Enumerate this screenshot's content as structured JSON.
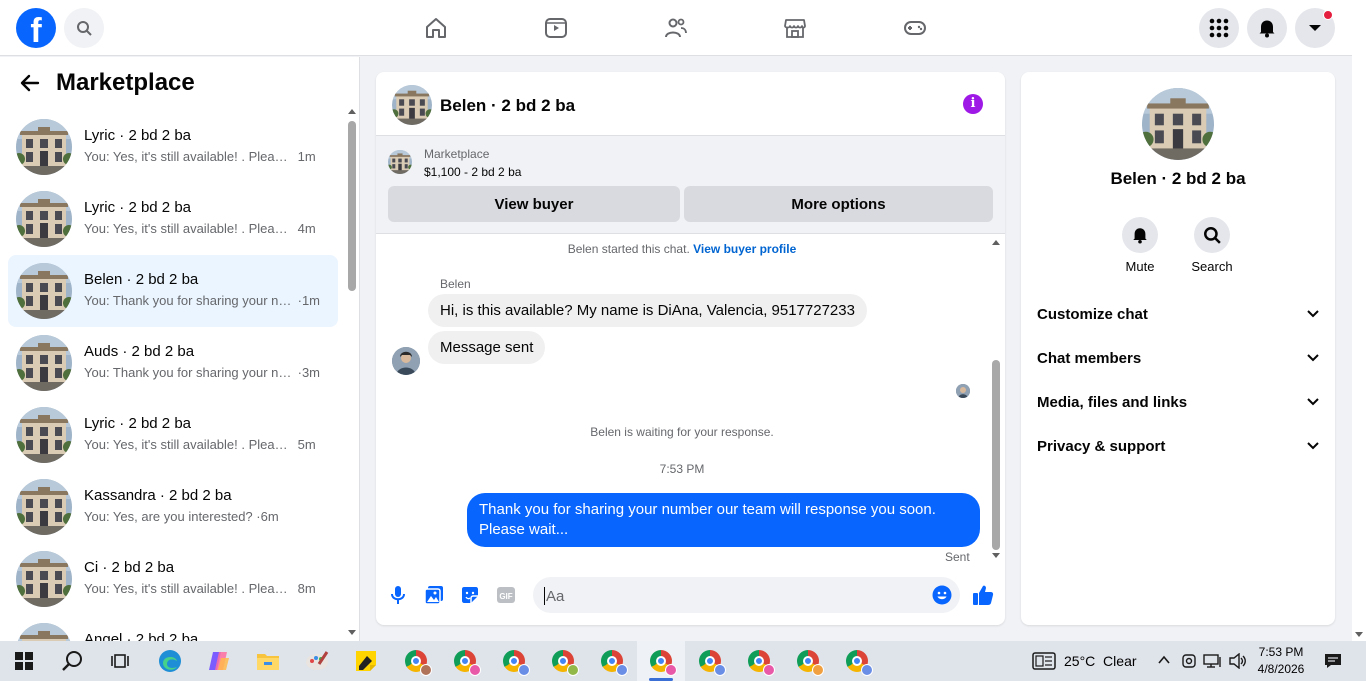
{
  "topbar": {
    "logo_letter": "f",
    "icons": [
      "search-icon",
      "home-icon",
      "video-icon",
      "friends-icon",
      "marketplace-icon",
      "gaming-icon",
      "menu-grid-icon",
      "notifications-bell-icon",
      "account-chevron-icon"
    ]
  },
  "sidebar": {
    "title": "Marketplace",
    "conversations": [
      {
        "name": "Lyric · 2 bd 2 ba",
        "snippet": "You: Yes, it's still available! . Please ...",
        "time": "1m",
        "active": false
      },
      {
        "name": "Lyric · 2 bd 2 ba",
        "snippet": "You: Yes, it's still available! . Please ...",
        "time": "4m",
        "active": false
      },
      {
        "name": "Belen · 2 bd 2 ba",
        "snippet": "You: Thank you for sharing your nu...",
        "time": "·1m",
        "active": true
      },
      {
        "name": "Auds · 2 bd 2 ba",
        "snippet": "You: Thank you for sharing your nu...",
        "time": "·3m",
        "active": false
      },
      {
        "name": "Lyric · 2 bd 2 ba",
        "snippet": "You: Yes, it's still available! . Please ...",
        "time": "5m",
        "active": false
      },
      {
        "name": "Kassandra · 2 bd 2 ba",
        "snippet": "You: Yes, are you interested?",
        "time": "·6m",
        "active": false
      },
      {
        "name": "Ci · 2 bd 2 ba",
        "snippet": "You: Yes, it's still available! . Please ...",
        "time": "8m",
        "active": false
      },
      {
        "name": "Angel · 2 bd 2 ba",
        "snippet": "",
        "time": "",
        "active": false
      }
    ]
  },
  "chat": {
    "title": "Belen · 2 bd 2 ba",
    "listing": {
      "label": "Marketplace",
      "price_title": "$1,100 - 2 bd 2 ba",
      "view_buyer": "View buyer",
      "more_options": "More options"
    },
    "started_text": "Belen started this chat.",
    "view_profile_link": "View buyer profile",
    "sender": "Belen",
    "incoming_1": "Hi, is this available? My name is DiAna, Valencia, 9517727233",
    "incoming_2": "Message sent",
    "waiting_text": "Belen is waiting for your response.",
    "timestamp": "7:53 PM",
    "outgoing": "Thank you for sharing your number our team will response you soon. Please wait...",
    "sent_label": "Sent",
    "composer_placeholder": "Aa"
  },
  "details": {
    "name": "Belen · 2 bd 2 ba",
    "mute_label": "Mute",
    "search_label": "Search",
    "sections": [
      "Customize chat",
      "Chat members",
      "Media, files and links",
      "Privacy & support"
    ]
  },
  "taskbar": {
    "weather": "25°C  Clear",
    "time": "7:53 PM",
    "date": "4/8/2026"
  },
  "colors": {
    "brand_blue": "#0866ff",
    "info_purple": "#9f19e6",
    "active_conv_bg": "#ebf5ff",
    "notification_dot": "#e41e3f"
  }
}
